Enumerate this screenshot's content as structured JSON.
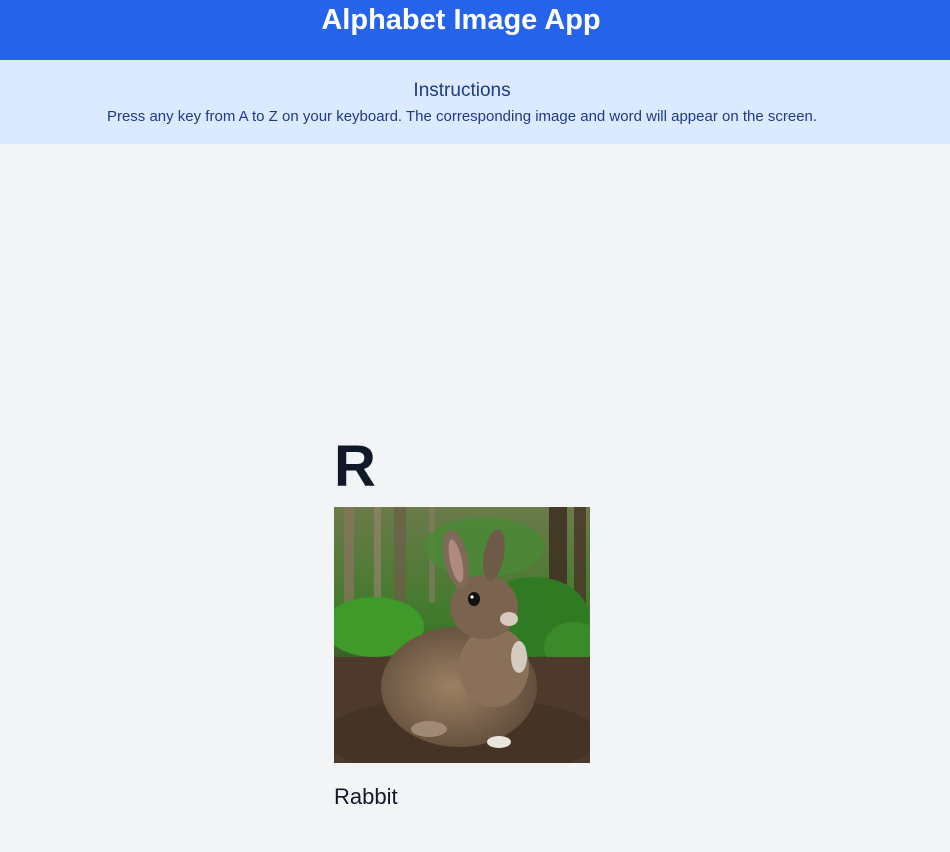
{
  "header": {
    "title": "Alphabet Image App",
    "background": "#2563eb"
  },
  "instructions": {
    "heading": "Instructions",
    "text": "Press any key from A to Z on your keyboard. The corresponding image and word will appear on the screen.",
    "background": "#dbeafe"
  },
  "display": {
    "letter": "R",
    "word": "Rabbit",
    "image_subject": "rabbit-photo"
  }
}
